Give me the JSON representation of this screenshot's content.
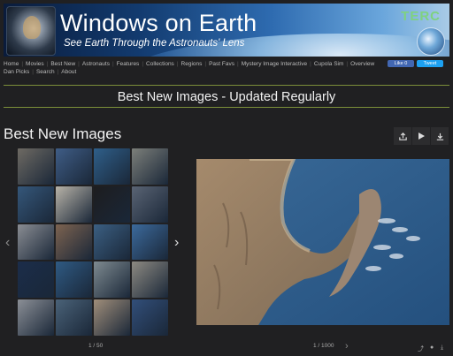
{
  "banner": {
    "title": "Windows on Earth",
    "subtitle": "See Earth Through the Astronauts' Lens",
    "org": "TERC"
  },
  "nav": {
    "items": [
      "Home",
      "Movies",
      "Best New",
      "Astronauts",
      "Features",
      "Collections",
      "Regions",
      "Past Favs",
      "Mystery Image Interactive",
      "Cupola Sim",
      "Overview",
      "Dan Picks",
      "Search",
      "About"
    ],
    "facebook_label": "Like 0",
    "twitter_label": "Tweet"
  },
  "page_heading": "Best New Images - Updated Regularly",
  "section_title": "Best New Images",
  "toolbar": {
    "share_icon": "share-icon",
    "play_icon": "play-icon",
    "download_icon": "download-icon"
  },
  "gallery": {
    "counter": "1 / 50",
    "thumbnails": [
      "#6e6a63",
      "#3f5d86",
      "#2f5f8a",
      "#7c7f7a",
      "#35577a",
      "#b8b3a8",
      "#1d1d1f",
      "#5a6474",
      "#8a8d93",
      "#7d6350",
      "#3b5f82",
      "#3c6a9c",
      "#1b2d4a",
      "#2f5a83",
      "#7e8a90",
      "#8d8a82",
      "#8b8f96",
      "#4a6278",
      "#a08e7a",
      "#324f7a"
    ]
  },
  "viewer": {
    "counter": "1 / 1000"
  },
  "colors": {
    "background": "#202022",
    "rule": "#7c8f3a",
    "facebook": "#4267b2",
    "twitter": "#1da1f2"
  }
}
